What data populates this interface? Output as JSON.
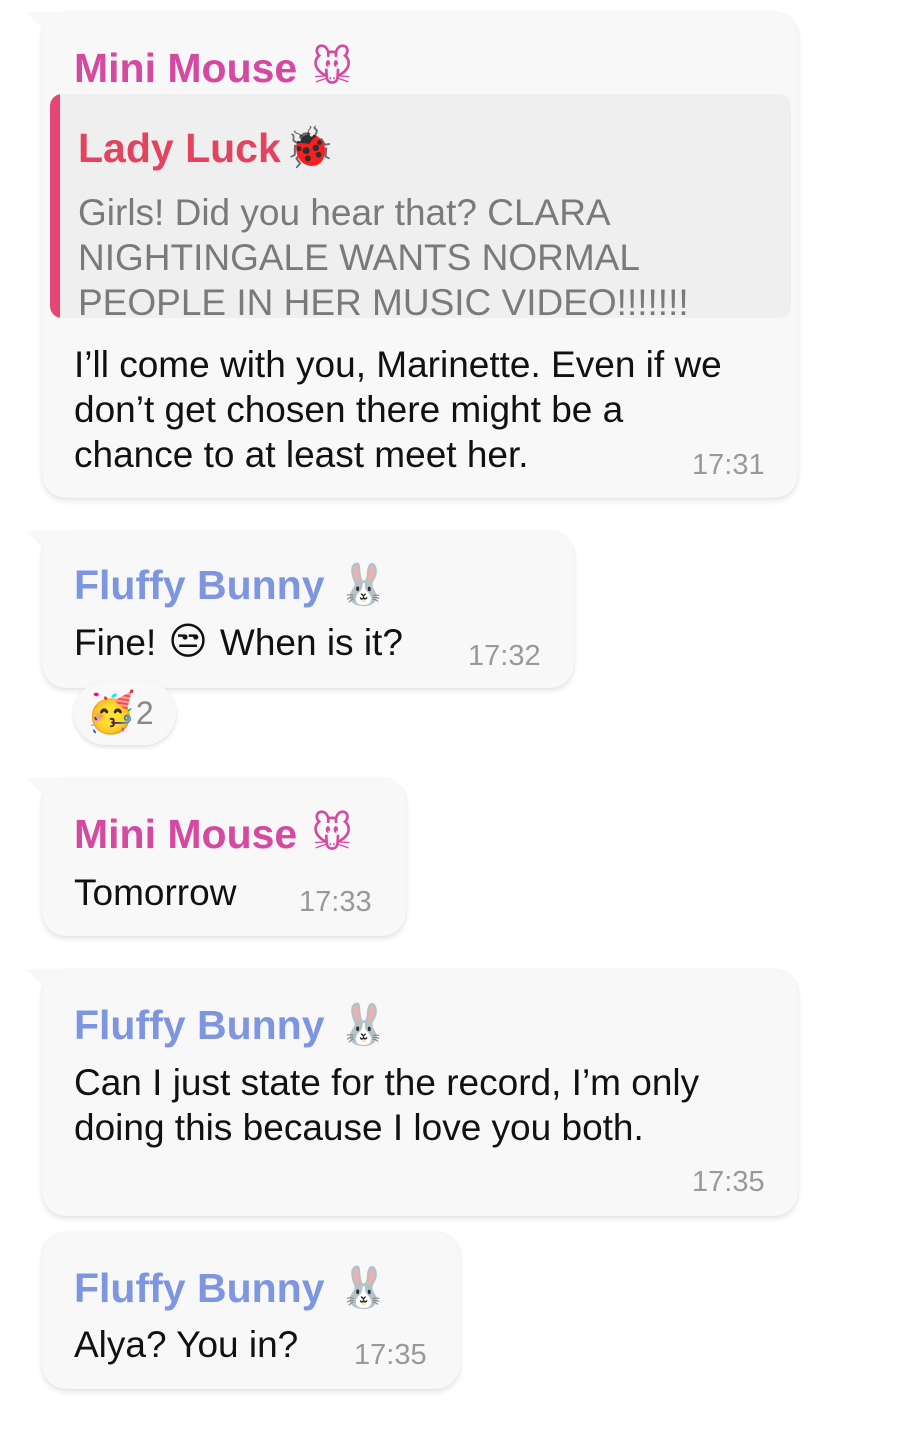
{
  "colors": {
    "mini_mouse": "#d44aa0",
    "fluffy_bunny": "#7e95e0",
    "lady_luck": "#e2445f",
    "quote_bar": "#e54774",
    "bubble_bg": "#f8f8f8",
    "timestamp": "#999999"
  },
  "messages": [
    {
      "sender": "Mini Mouse",
      "sender_icon": "mouse-face-emoji",
      "sender_emoji": "🐭",
      "reply": {
        "sender": "Lady Luck",
        "sender_icon": "lady-beetle-emoji",
        "sender_emoji": "🐞",
        "text": "Girls! Did you hear that? CLARA\nNIGHTINGALE WANTS NORMAL\nPEOPLE IN HER MUSIC VIDEO!!!!!!!"
      },
      "text": "I’ll come with you, Marinette. Even if we\ndon’t get chosen there might be a\nchance to at least meet her.",
      "time": "17:31"
    },
    {
      "sender": "Fluffy Bunny",
      "sender_icon": "rabbit-face-emoji",
      "sender_emoji": "🐰",
      "text_before": "Fine!",
      "inline_icon": "unamused-face-emoji",
      "inline_emoji": "😒",
      "text_after": "When is it?",
      "time": "17:32",
      "reaction": {
        "icon": "partying-face-emoji",
        "emoji": "🥳",
        "count": "2"
      }
    },
    {
      "sender": "Mini Mouse",
      "sender_icon": "mouse-face-emoji",
      "sender_emoji": "🐭",
      "text": "Tomorrow",
      "time": "17:33"
    },
    {
      "sender": "Fluffy Bunny",
      "sender_icon": "rabbit-face-emoji",
      "sender_emoji": "🐰",
      "text": "Can I just state for the record, I’m only\ndoing this because I love you both.",
      "time": "17:35"
    },
    {
      "sender": "Fluffy Bunny",
      "sender_icon": "rabbit-face-emoji",
      "sender_emoji": "🐰",
      "text": "Alya? You in?",
      "time": "17:35"
    }
  ]
}
